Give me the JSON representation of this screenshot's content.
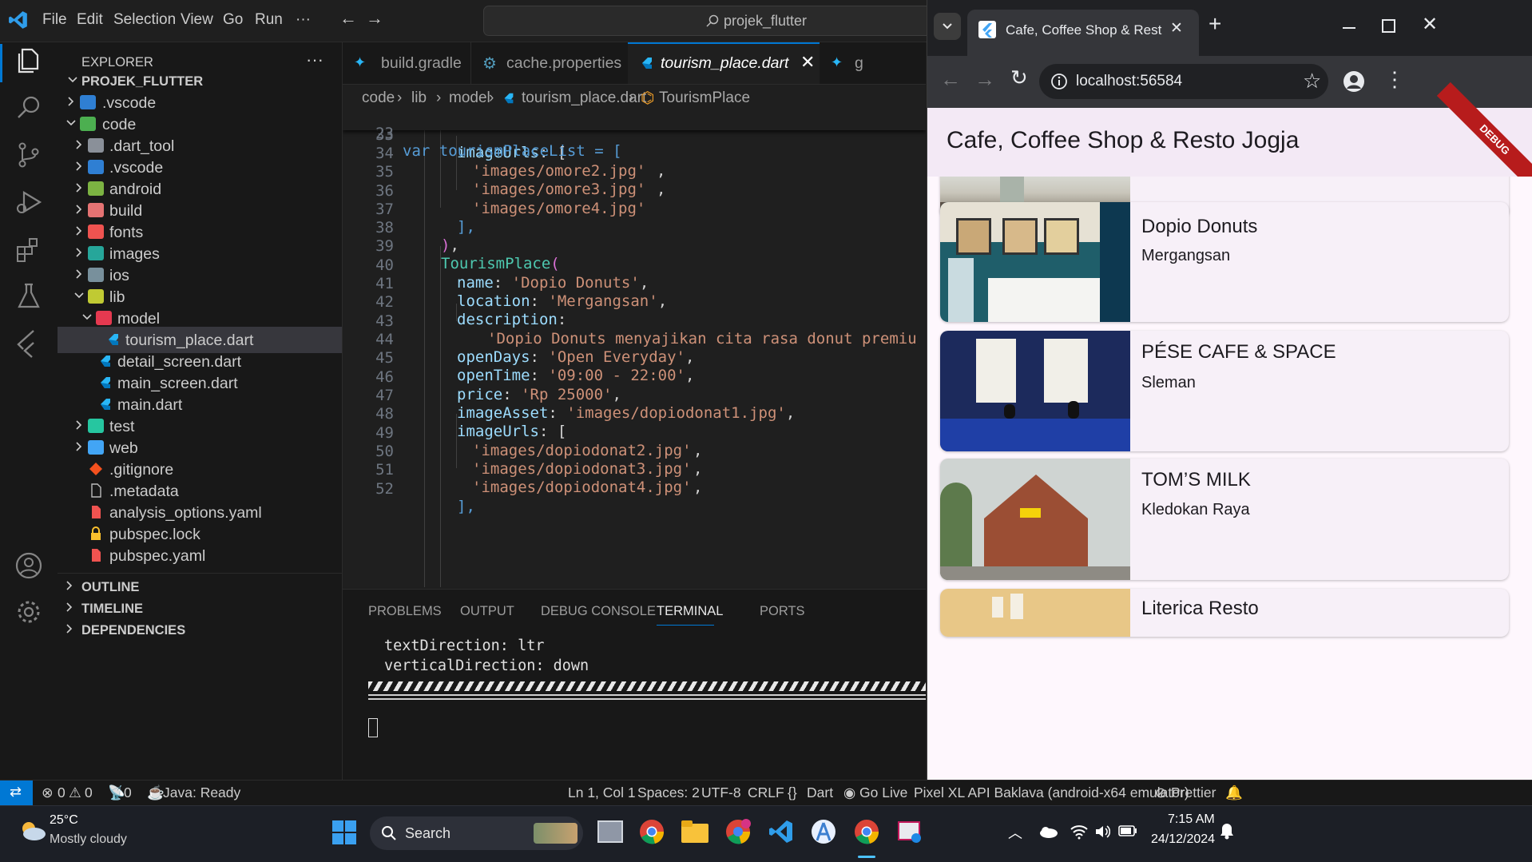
{
  "titlebar": {
    "menu": [
      "File",
      "Edit",
      "Selection",
      "View",
      "Go",
      "Run",
      "···"
    ],
    "search_text": "projek_flutter"
  },
  "explorer": {
    "title": "EXPLORER",
    "more": "···",
    "root": "PROJEK_FLUTTER",
    "items": [
      {
        "label": ".vscode"
      },
      {
        "label": "code"
      },
      {
        "label": ".dart_tool"
      },
      {
        "label": ".vscode"
      },
      {
        "label": "android"
      },
      {
        "label": "build"
      },
      {
        "label": "fonts"
      },
      {
        "label": "images"
      },
      {
        "label": "ios"
      },
      {
        "label": "lib"
      },
      {
        "label": "model"
      },
      {
        "label": "tourism_place.dart"
      },
      {
        "label": "detail_screen.dart"
      },
      {
        "label": "main_screen.dart"
      },
      {
        "label": "main.dart"
      },
      {
        "label": "test"
      },
      {
        "label": "web"
      },
      {
        "label": ".gitignore"
      },
      {
        "label": ".metadata"
      },
      {
        "label": "analysis_options.yaml"
      },
      {
        "label": "pubspec.lock"
      },
      {
        "label": "pubspec.yaml"
      }
    ],
    "sections": [
      "OUTLINE",
      "TIMELINE",
      "DEPENDENCIES"
    ]
  },
  "editor": {
    "tabs": [
      "build.gradle",
      "cache.properties",
      "tourism_place.dart",
      "g"
    ],
    "breadcrumb": [
      "code",
      "lib",
      "model",
      "tourism_place.dart",
      "TourismPlace"
    ],
    "sticky_line": {
      "num": "23",
      "text": "var tourismPlaceList = ["
    },
    "lines": [
      {
        "num": "33"
      },
      {
        "num": "34"
      },
      {
        "num": "35"
      },
      {
        "num": "36"
      },
      {
        "num": "37"
      },
      {
        "num": "38"
      },
      {
        "num": "39"
      },
      {
        "num": "40"
      },
      {
        "num": "41"
      },
      {
        "num": "42"
      },
      {
        "num": "43"
      },
      {
        "num": "44"
      },
      {
        "num": "45"
      },
      {
        "num": "46"
      },
      {
        "num": "47"
      },
      {
        "num": "48"
      },
      {
        "num": "49"
      },
      {
        "num": "50"
      },
      {
        "num": "51"
      },
      {
        "num": "52"
      }
    ],
    "code": {
      "l33a": "imageUrls",
      "l33b": ": [",
      "l34": "'images/omore2.jpg'",
      "l35": "'images/omore3.jpg'",
      "l36": "'images/omore4.jpg'",
      "l37": "],",
      "l38a": ")",
      "l38b": ",",
      "l39a": "TourismPlace",
      "l39b": "(",
      "l40a": "name",
      "l40b": "'Dopio Donuts'",
      "l41a": "location",
      "l41b": "'Mergangsan'",
      "l42a": "description",
      "l42b": ":",
      "l43": "'Dopio Donuts menyajikan cita rasa donut premiu",
      "l44a": "openDays",
      "l44b": "'Open Everyday'",
      "l45a": "openTime",
      "l45b": "'09:00 - 22:00'",
      "l46a": "price",
      "l46b": "'Rp 25000'",
      "l47a": "imageAsset",
      "l47b": "'images/dopiodonat1.jpg'",
      "l48a": "imageUrls",
      "l48b": ": [",
      "l49": "'images/dopiodonat2.jpg'",
      "l50": "'images/dopiodonat3.jpg'",
      "l51": "'images/dopiodonat4.jpg'",
      "l52": "],",
      "sep": ": ",
      "comma": ","
    }
  },
  "panel": {
    "tabs": [
      "PROBLEMS",
      "OUTPUT",
      "DEBUG CONSOLE",
      "TERMINAL",
      "PORTS"
    ],
    "terminal_lines": [
      "textDirection: ltr",
      "verticalDirection: down"
    ]
  },
  "browser": {
    "tab_title": "Cafe, Coffee Shop & Resto Jogja",
    "url": "localhost:56584",
    "app_title": "Cafe, Coffee Shop & Resto Jogja",
    "debug_banner": "DEBUG",
    "places": [
      {
        "name": "Dopio Donuts",
        "location": "Mergangsan"
      },
      {
        "name": "PÉSE CAFE & SPACE",
        "location": "Sleman"
      },
      {
        "name": "TOM’S MILK",
        "location": "Kledokan Raya"
      },
      {
        "name": "Literica Resto",
        "location": ""
      }
    ]
  },
  "statusbar": {
    "errors": "0",
    "warnings": "0",
    "ports": "0",
    "java": "Java: Ready",
    "position": "Ln 1, Col 1",
    "spaces": "Spaces: 2",
    "encoding": "UTF-8",
    "eol": "CRLF",
    "language": "Dart",
    "golive": "Go Live",
    "device": "Pixel XL API Baklava (android-x64 emulator)",
    "prettier": "Prettier"
  },
  "taskbar": {
    "temp": "25°C",
    "weather": "Mostly cloudy",
    "search": "Search",
    "time": "7:15 AM",
    "date": "24/12/2024"
  },
  "colors": {
    "accent": "#0078d4",
    "app_bar": "#f3e9f5",
    "debug_banner": "#b71c1c"
  }
}
